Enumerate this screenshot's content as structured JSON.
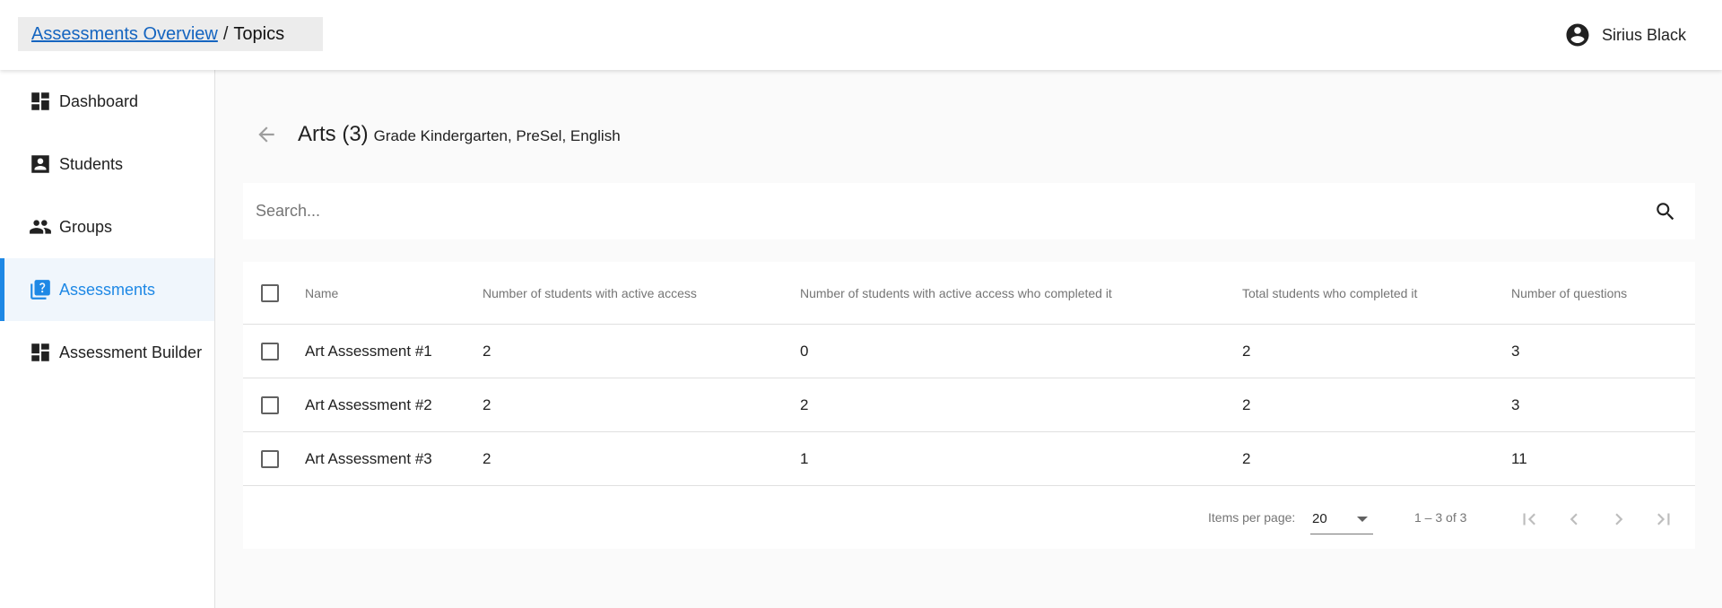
{
  "header": {
    "breadcrumb_link": "Assessments Overview",
    "breadcrumb_sep": "/",
    "breadcrumb_current": "Topics",
    "user_name": "Sirius Black"
  },
  "sidebar": {
    "items": [
      {
        "label": "Dashboard",
        "icon": "dashboard-icon"
      },
      {
        "label": "Students",
        "icon": "contact-card-icon"
      },
      {
        "label": "Groups",
        "icon": "people-icon"
      },
      {
        "label": "Assessments",
        "icon": "quiz-icon",
        "active": true
      },
      {
        "label": "Assessment Builder",
        "icon": "dashboard-icon"
      }
    ]
  },
  "page": {
    "title": "Arts (3)",
    "subtitle": "Grade Kindergarten, PreSel, English"
  },
  "search": {
    "placeholder": "Search...",
    "value": ""
  },
  "table": {
    "columns": [
      "Name",
      "Number of students with active access",
      "Number of students with active access who completed it",
      "Total students who completed it",
      "Number of questions"
    ],
    "rows": [
      [
        "Art Assessment #1",
        "2",
        "0",
        "2",
        "3"
      ],
      [
        "Art Assessment #2",
        "2",
        "2",
        "2",
        "3"
      ],
      [
        "Art Assessment #3",
        "2",
        "1",
        "2",
        "11"
      ]
    ]
  },
  "paginator": {
    "items_per_page_label": "Items per page:",
    "items_per_page_value": "20",
    "range_label": "1 – 3 of 3"
  },
  "colors": {
    "accent": "#1e88e5",
    "link": "#1565c0",
    "active_bg": "#f0f6fc"
  }
}
